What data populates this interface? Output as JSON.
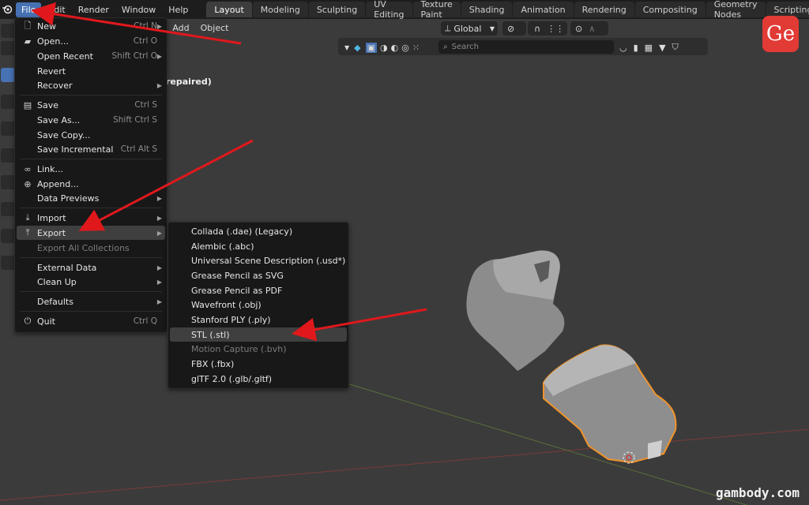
{
  "topbar": {
    "menus": [
      "File",
      "Edit",
      "Render",
      "Window",
      "Help"
    ],
    "workspace_tabs": [
      "Layout",
      "Modeling",
      "Sculpting",
      "UV Editing",
      "Texture Paint",
      "Shading",
      "Animation",
      "Rendering",
      "Compositing",
      "Geometry Nodes",
      "Scripting"
    ],
    "plus": "+"
  },
  "viewport_header": {
    "menus": [
      "t",
      "Add",
      "Object"
    ],
    "orientation": "Global",
    "search_placeholder": "Search"
  },
  "scene_status": "repaired)",
  "file_menu": {
    "items": [
      {
        "label": "New",
        "shortcut": "Ctrl N",
        "icon": "new-file-icon",
        "arrow": true
      },
      {
        "label": "Open...",
        "shortcut": "Ctrl O",
        "icon": "folder-icon"
      },
      {
        "label": "Open Recent",
        "shortcut": "Shift Ctrl O",
        "icon": "",
        "arrow": true
      },
      {
        "label": "Revert",
        "shortcut": "",
        "icon": ""
      },
      {
        "label": "Recover",
        "shortcut": "",
        "icon": "",
        "arrow": true
      },
      {
        "label": "Save",
        "shortcut": "Ctrl S",
        "icon": "save-icon"
      },
      {
        "label": "Save As...",
        "shortcut": "Shift Ctrl S",
        "icon": ""
      },
      {
        "label": "Save Copy...",
        "shortcut": "",
        "icon": ""
      },
      {
        "label": "Save Incremental",
        "shortcut": "Ctrl Alt S",
        "icon": ""
      },
      {
        "label": "Link...",
        "shortcut": "",
        "icon": "link-icon"
      },
      {
        "label": "Append...",
        "shortcut": "",
        "icon": "append-icon"
      },
      {
        "label": "Data Previews",
        "shortcut": "",
        "icon": "",
        "arrow": true
      },
      {
        "label": "Import",
        "shortcut": "",
        "icon": "import-icon",
        "arrow": true
      },
      {
        "label": "Export",
        "shortcut": "",
        "icon": "export-icon",
        "arrow": true
      },
      {
        "label": "Export All Collections",
        "shortcut": "",
        "icon": ""
      },
      {
        "label": "External Data",
        "shortcut": "",
        "icon": "",
        "arrow": true
      },
      {
        "label": "Clean Up",
        "shortcut": "",
        "icon": "",
        "arrow": true
      },
      {
        "label": "Defaults",
        "shortcut": "",
        "icon": "",
        "arrow": true
      },
      {
        "label": "Quit",
        "shortcut": "Ctrl Q",
        "icon": "power-icon"
      }
    ]
  },
  "export_menu": {
    "items": [
      "Collada (.dae) (Legacy)",
      "Alembic (.abc)",
      "Universal Scene Description (.usd*)",
      "Grease Pencil as SVG",
      "Grease Pencil as PDF",
      "Wavefront (.obj)",
      "Stanford PLY (.ply)",
      "STL (.stl)",
      "Motion Capture (.bvh)",
      "FBX (.fbx)",
      "glTF 2.0 (.glb/.gltf)"
    ]
  },
  "badge": "Ge",
  "watermark": "gambody.com",
  "colors": {
    "accent": "#4772b3",
    "arrow": "#e0181c",
    "selection_outline": "#f0932b",
    "badge": "#e23a35"
  }
}
